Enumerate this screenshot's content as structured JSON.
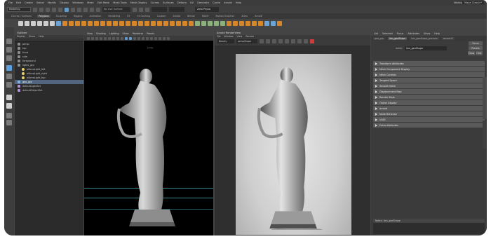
{
  "menubar": {
    "items": [
      "File",
      "Edit",
      "Create",
      "Select",
      "Modify",
      "Display",
      "Windows",
      "Mesh",
      "Edit Mesh",
      "Mesh Tools",
      "Mesh Display",
      "Curves",
      "Surfaces",
      "Deform",
      "UV",
      "Generate",
      "Cache",
      "Arnold",
      "Help"
    ],
    "workspace_label": "Workspace:",
    "workspace_value": "Maya Classic*"
  },
  "statusbar": {
    "mode": "Modeling",
    "live_surface": "No Live Surface",
    "render_label": "Zero Physo"
  },
  "shelf": {
    "tabs": [
      "Curves / Surfaces",
      "Polygons",
      "Sculpting",
      "Rigging",
      "Animation",
      "Rendering",
      "FX",
      "FX Caching",
      "Custom",
      "Arnold",
      "Bifrost",
      "MASH",
      "Motion Graphics",
      "XGen",
      "Arnold"
    ],
    "active_tab": 1
  },
  "outliner": {
    "title": "Outliner",
    "menu": [
      "Display",
      "Show",
      "Help"
    ],
    "items": [
      {
        "label": "persp",
        "icon": "camera-icon"
      },
      {
        "label": "top",
        "icon": "camera-icon"
      },
      {
        "label": "front",
        "icon": "camera-icon"
      },
      {
        "label": "side",
        "icon": "camera-icon"
      },
      {
        "label": "foreground",
        "icon": "group-icon"
      },
      {
        "label": "lights_grp",
        "icon": "group-icon"
      },
      {
        "label": "aiAreaLight_left",
        "icon": "light-icon"
      },
      {
        "label": "aiAreaLight_right",
        "icon": "light-icon"
      },
      {
        "label": "aiAreaLight_top",
        "icon": "light-icon"
      },
      {
        "label": "geo_grp",
        "icon": "mesh-icon",
        "selected": true
      },
      {
        "label": "defaultLightSet",
        "icon": "set-icon"
      },
      {
        "label": "defaultObjectSet",
        "icon": "set-icon"
      }
    ]
  },
  "viewport": {
    "menu": [
      "View",
      "Shading",
      "Lighting",
      "Show",
      "Renderer",
      "Panels"
    ],
    "camera_label": "persp"
  },
  "renderview": {
    "title": "Arnold RenderView",
    "menu": [
      "File",
      "Window",
      "View",
      "Render"
    ],
    "camera_field": "Beauty",
    "aov_field": "perspShape"
  },
  "attribute_editor": {
    "menu": [
      "List",
      "Selected",
      "Focus",
      "Attributes",
      "Show",
      "Help"
    ],
    "tabs": [
      "geo_grp",
      "lion_geoShape",
      "lion_geoShape_preview",
      "lambert1"
    ],
    "active_tab": 1,
    "shape_label": "mesh:",
    "shape_value": "lion_geoShape",
    "buttons": [
      "Focus",
      "Presets",
      "Show",
      "Hide"
    ],
    "sections": [
      "Transform Attributes",
      "Mesh Component Display",
      "Mesh Controls",
      "Tangent Space",
      "Smooth Mesh",
      "Displacement Map",
      "Render Stats",
      "Object Display",
      "Arnold",
      "Node Behavior",
      "UUID",
      "Extra Attributes"
    ],
    "notes_label": "Notes: lion_geoShape"
  }
}
